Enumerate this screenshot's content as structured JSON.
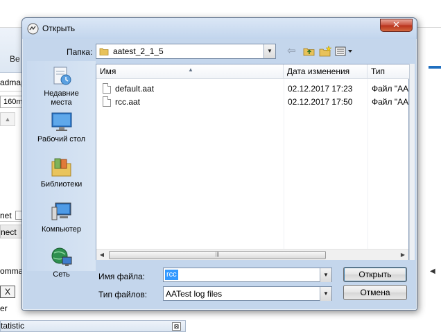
{
  "background_app": {
    "toolbar_text": "Be",
    "admap_text": "admap",
    "zoom_value": "160m",
    "net_text": "net",
    "nect_text": "nect",
    "command_text": "ommand",
    "x_button": "X",
    "er_text": "er",
    "statistic_title": "tatistic",
    "statistic_close": "⊠"
  },
  "dialog": {
    "title": "Открыть",
    "close_glyph": "✕",
    "look_in_label": "Папка:",
    "look_in_value": "aatest_2_1_5",
    "places": [
      {
        "label_line1": "Недавние",
        "label_line2": "места",
        "icon": "recent-places-icon"
      },
      {
        "label_line1": "Рабочий стол",
        "label_line2": "",
        "icon": "desktop-icon"
      },
      {
        "label_line1": "Библиотеки",
        "label_line2": "",
        "icon": "libraries-icon"
      },
      {
        "label_line1": "Компьютер",
        "label_line2": "",
        "icon": "computer-icon"
      },
      {
        "label_line1": "Сеть",
        "label_line2": "",
        "icon": "network-icon"
      }
    ],
    "columns": {
      "name": "Имя",
      "date": "Дата изменения",
      "type": "Тип"
    },
    "files": [
      {
        "name": "default.aat",
        "date": "02.12.2017 17:23",
        "type": "Файл \"AA"
      },
      {
        "name": "rcc.aat",
        "date": "02.12.2017 17:50",
        "type": "Файл \"AA"
      }
    ],
    "file_name_label": "Имя файла:",
    "file_name_value": "rcc",
    "file_type_label": "Тип файлов:",
    "file_type_value": "AATest log files",
    "open_button": "Открыть",
    "cancel_button": "Отмена"
  },
  "colors": {
    "dialog_frame": "#c4d6ec",
    "close_button": "#c9503c",
    "selection": "#3399ff",
    "accent_dash": "#1f6fc0"
  }
}
